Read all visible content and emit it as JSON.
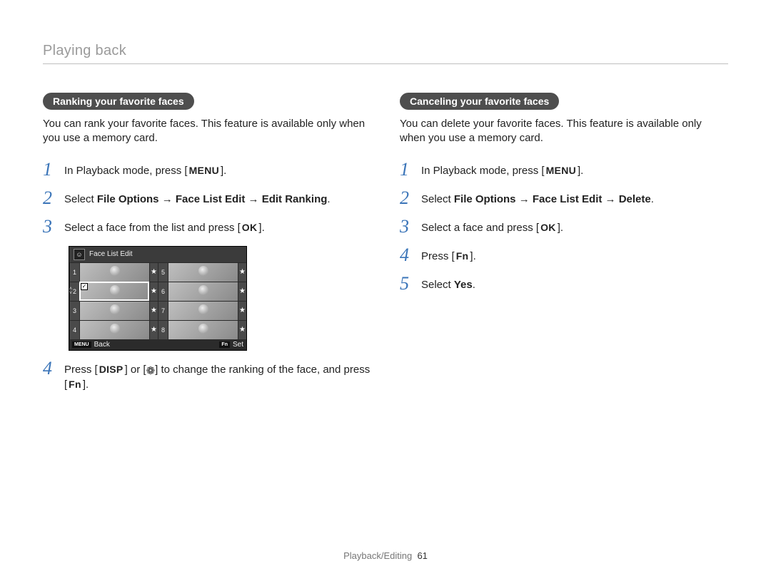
{
  "header": "Playing back",
  "left": {
    "pill": "Ranking your favorite faces",
    "intro": "You can rank your favorite faces. This feature is available only when you use a memory card.",
    "steps": {
      "s1": {
        "num": "1",
        "pre": "In Playback mode, press [",
        "btn": "MENU",
        "post": "]."
      },
      "s2": {
        "num": "2",
        "pre": "Select ",
        "bold": "File Options → Face List Edit → Edit Ranking",
        "post": "."
      },
      "s3": {
        "num": "3",
        "pre": "Select a face from the list and press [",
        "btn": "OK",
        "post": "]."
      },
      "s4": {
        "num": "4",
        "pre1": "Press [",
        "btn1": "DISP",
        "mid": "] or [",
        "glyph": "❁",
        "post1": "] to change the ranking of the face, and press [",
        "btn2": "Fn",
        "post2": "]."
      }
    },
    "lcd": {
      "title": "Face List Edit",
      "nums": [
        "1",
        "2",
        "3",
        "4",
        "5",
        "6",
        "7",
        "8"
      ],
      "back_tag": "MENU",
      "back": "Back",
      "set_tag": "Fn",
      "set": "Set"
    }
  },
  "right": {
    "pill": "Canceling your favorite faces",
    "intro": "You can delete your favorite faces. This feature is available only when you use a memory card.",
    "steps": {
      "s1": {
        "num": "1",
        "pre": "In Playback mode, press [",
        "btn": "MENU",
        "post": "]."
      },
      "s2": {
        "num": "2",
        "pre": "Select ",
        "bold": "File Options → Face List Edit → Delete",
        "post": "."
      },
      "s3": {
        "num": "3",
        "pre": "Select a face and press [",
        "btn": "OK",
        "post": "]."
      },
      "s4": {
        "num": "4",
        "pre": "Press [",
        "btn": "Fn",
        "post": "]."
      },
      "s5": {
        "num": "5",
        "pre": "Select ",
        "bold": "Yes",
        "post": "."
      }
    }
  },
  "footer": {
    "section": "Playback/Editing",
    "page": "61"
  }
}
